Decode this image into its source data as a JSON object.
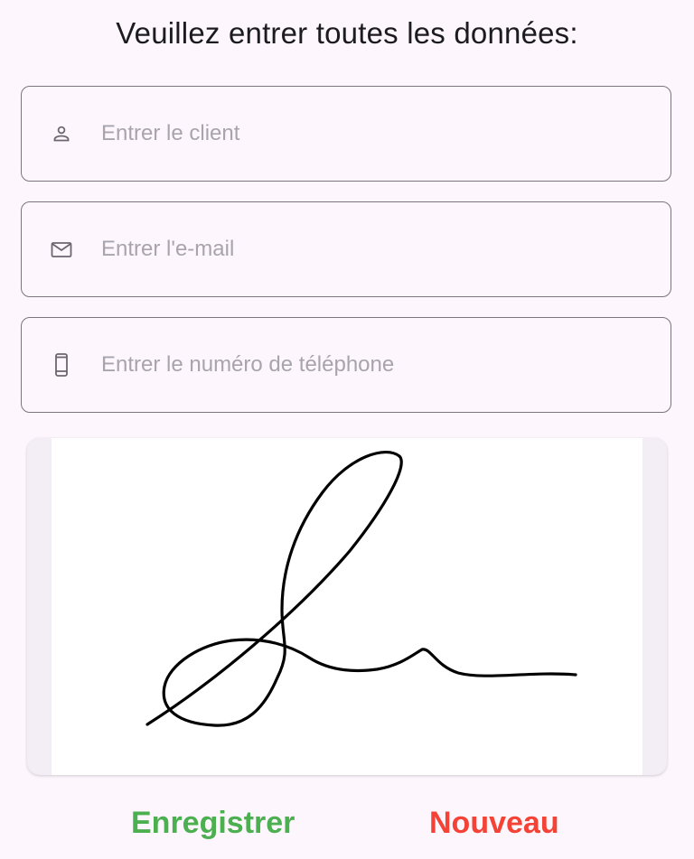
{
  "header": {
    "title": "Veuillez entrer toutes les données:"
  },
  "form": {
    "client": {
      "icon": "person-icon",
      "placeholder": "Entrer le client",
      "value": ""
    },
    "email": {
      "icon": "mail-icon",
      "placeholder": "Entrer l'e-mail",
      "value": ""
    },
    "phone": {
      "icon": "smartphone-icon",
      "placeholder": "Entrer le numéro de téléphone",
      "value": ""
    }
  },
  "signature": {
    "stroke_color": "#000000",
    "background_color": "#ffffff"
  },
  "actions": {
    "save_label": "Enregistrer",
    "save_color": "#4caf50",
    "new_label": "Nouveau",
    "new_color": "#f44336"
  }
}
